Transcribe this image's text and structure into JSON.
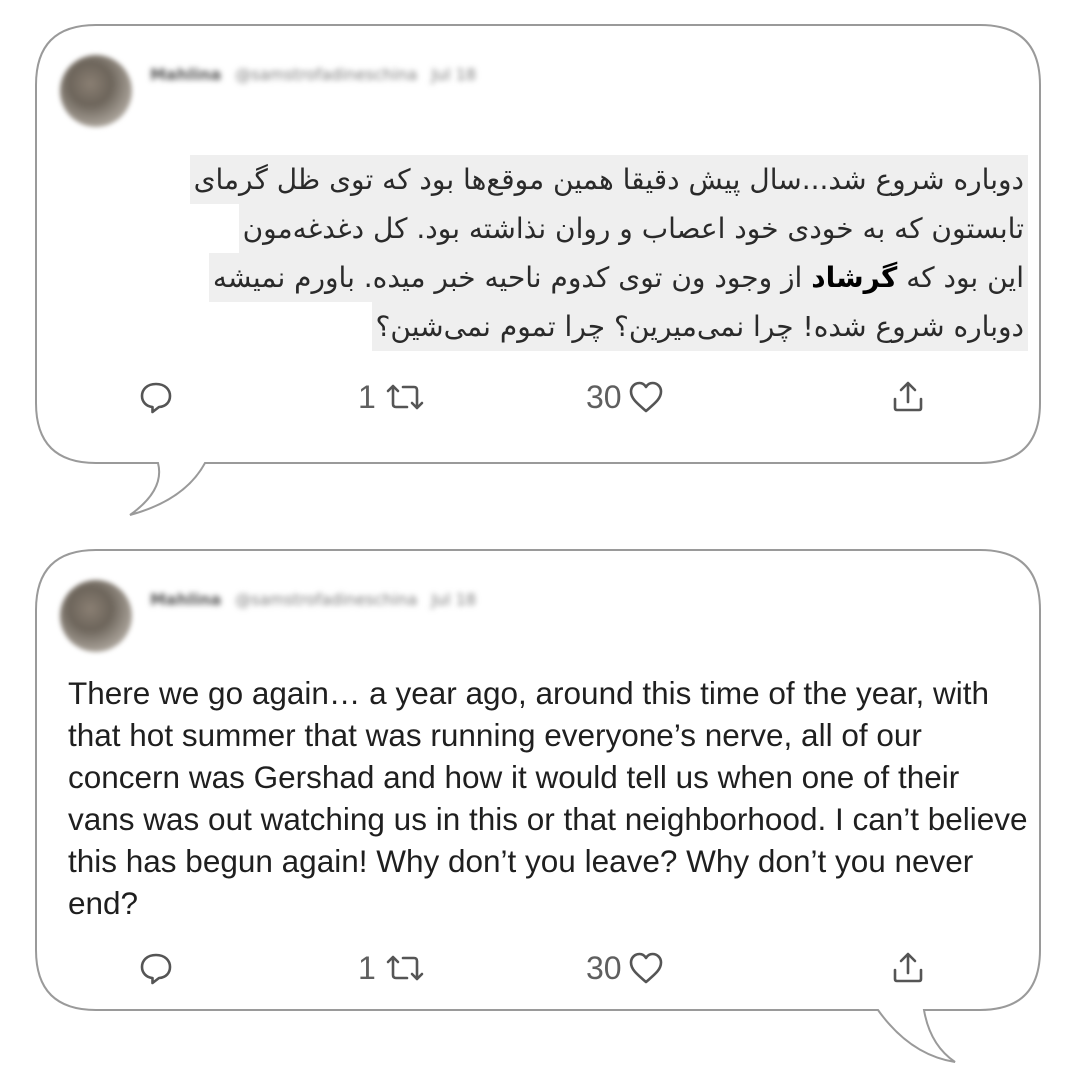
{
  "tweets": [
    {
      "language": "fa",
      "author_name": "Mahlina",
      "author_handle": "@samstrofadineschina",
      "time": "Jul 18",
      "text_lines": [
        {
          "text": "دوباره شروع شد...سال پیش دقیقا همین موقع‌ها بود که توی ظل گرمای"
        },
        {
          "text": "تابستون که به خودی خود اعصاب و روان نذاشته بود. کل دغدغه‌مون"
        },
        {
          "pre": "این بود که ",
          "bold": "گرشاد",
          "post": " از وجود ون توی کدوم ناحیه خبر میده. باورم نمیشه"
        },
        {
          "text": "دوباره شروع شده! چرا نمی‌میرین؟ چرا تموم نمی‌شین؟"
        }
      ],
      "retweet_count": "1",
      "like_count": "30"
    },
    {
      "language": "en",
      "author_name": "Mahlina",
      "author_handle": "@samstrofadineschina",
      "time": "Jul 18",
      "text": "There we go again… a year ago, around this time of the year, with that hot summer that was running everyone’s nerve, all of our concern was Gershad and how it would tell us when one of their vans was out watching us in this or that neighborhood. I can’t believe this has begun again! Why don’t you leave? Why don’t you never end?",
      "retweet_count": "1",
      "like_count": "30"
    }
  ],
  "icons": {
    "reply": "reply-icon",
    "retweet": "retweet-icon",
    "like": "heart-icon",
    "share": "share-icon"
  },
  "colors": {
    "outline": "#9a9a9a",
    "text": "#1f1f1f",
    "action": "#5f5f5f",
    "highlight": "#efefef"
  }
}
